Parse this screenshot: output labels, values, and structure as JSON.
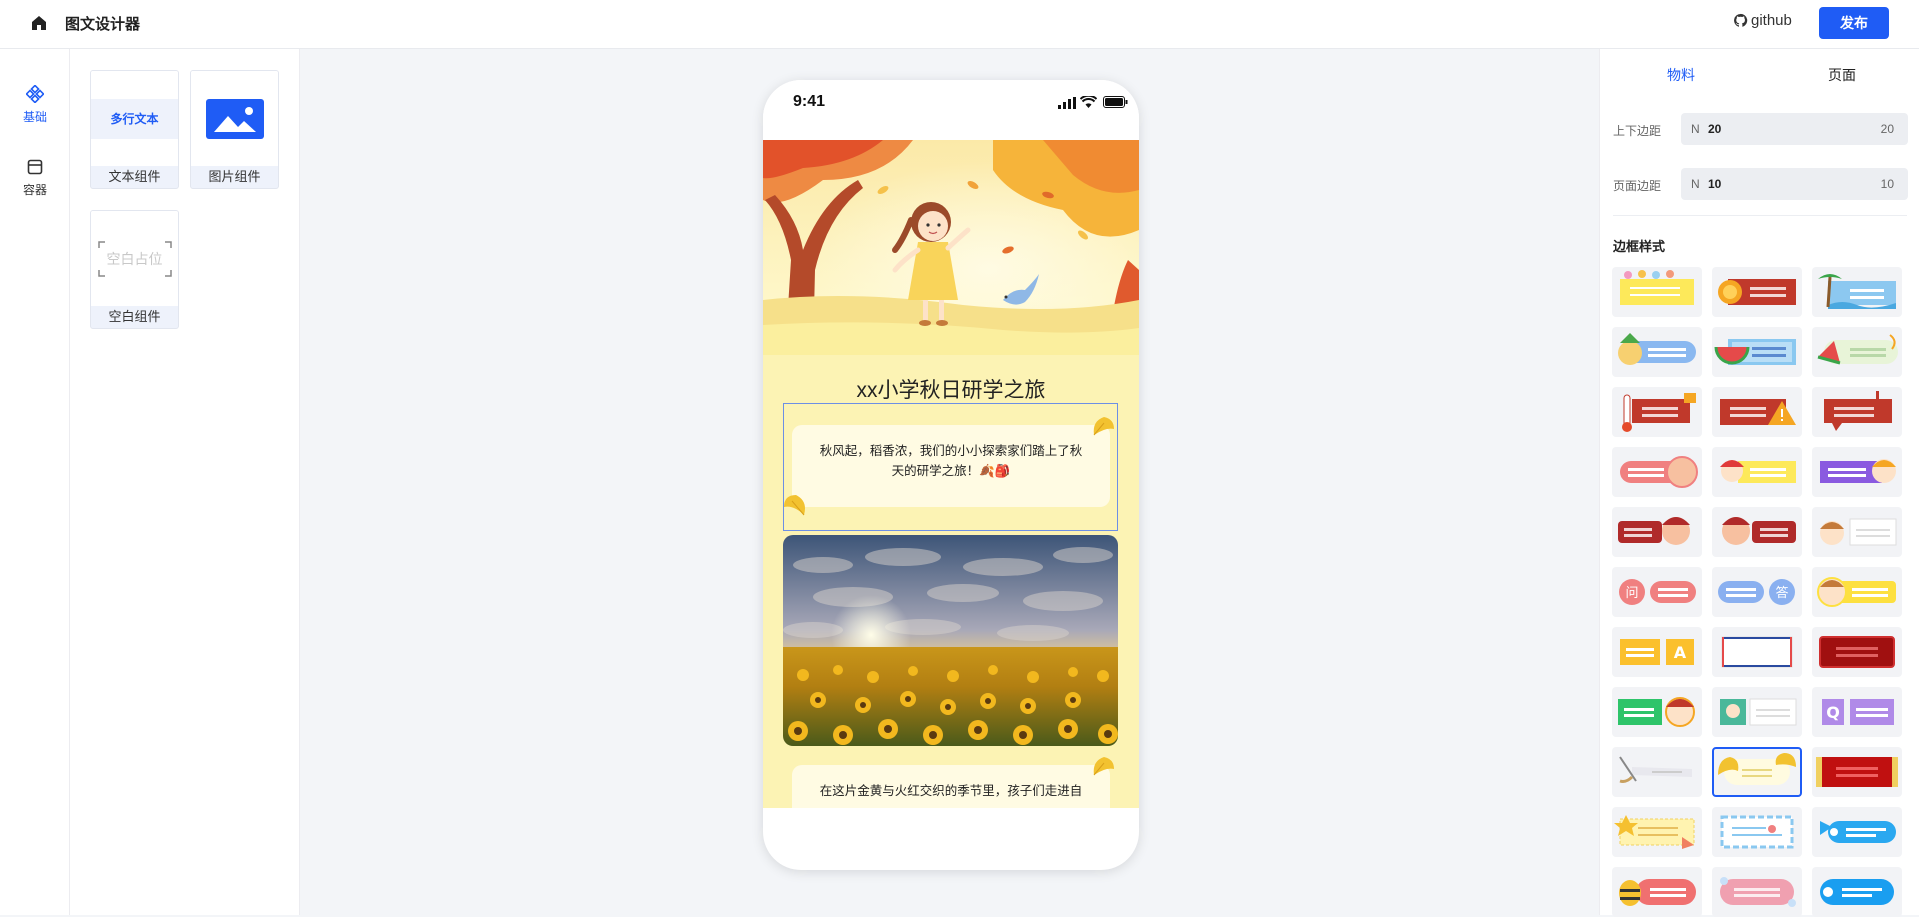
{
  "header": {
    "app_title": "图文设计器",
    "github_label": "github",
    "publish_label": "发布"
  },
  "rail": {
    "items": [
      {
        "label": "基础",
        "icon": "component-icon",
        "active": true
      },
      {
        "label": "容器",
        "icon": "box-icon",
        "active": false
      }
    ]
  },
  "components": [
    {
      "label": "文本组件",
      "thumb_text": "多行文本"
    },
    {
      "label": "图片组件",
      "thumb_icon": "image-icon"
    },
    {
      "label": "空白组件",
      "thumb_text": "空白占位"
    }
  ],
  "phone": {
    "time": "9:41",
    "page_title": "xx小学秋日研学之旅",
    "card1_text": "秋风起，稻香浓，我们的小小探索家们踏上了秋天的研学之旅！🍂🎒",
    "card2_text": "在这片金黄与火红交织的季节里，孩子们走进自"
  },
  "right_panel": {
    "tabs": [
      "物料",
      "页面"
    ],
    "active_tab": "物料",
    "vertical_margin": {
      "label": "上下边距",
      "prefix": "N",
      "value": "20",
      "right_value": "20"
    },
    "page_margin": {
      "label": "页面边距",
      "prefix": "N",
      "value": "10",
      "right_value": "10"
    },
    "border_section_title": "边框样式",
    "border_styles_count": 33,
    "selected_style_index": 28,
    "style_badges": {
      "q": "问",
      "a": "答",
      "letter_a": "A",
      "letter_q": "Q"
    }
  },
  "colors": {
    "accent": "#1f5cf5",
    "canvas_bg": "#f3f5f8",
    "page_bg": "#fcf3b4"
  }
}
